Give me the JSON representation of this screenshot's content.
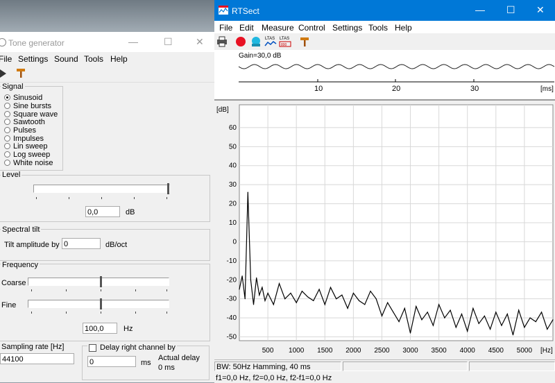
{
  "tone_generator": {
    "title": "Tone generator",
    "menu": [
      "File",
      "Settings",
      "Sound",
      "Tools",
      "Help"
    ],
    "signal": {
      "label": "Signal",
      "options": [
        "Sinusoid",
        "Sine bursts",
        "Square wave",
        "Sawtooth",
        "Pulses",
        "Impulses",
        "Lin sweep",
        "Log sweep",
        "White noise"
      ],
      "selected": "Sinusoid"
    },
    "level": {
      "label": "Level",
      "value": "0,0",
      "unit": "dB"
    },
    "spectral_tilt": {
      "label": "Spectral tilt",
      "field_label": "Tilt amplitude by",
      "value": "0",
      "unit": "dB/oct"
    },
    "frequency": {
      "label": "Frequency",
      "coarse_label": "Coarse",
      "fine_label": "Fine",
      "value": "100,0",
      "unit": "Hz"
    },
    "sampling_rate": {
      "label": "Sampling rate [Hz]",
      "value": "44100"
    },
    "delay": {
      "checkbox_label": "Delay right channel by",
      "value": "0",
      "unit": "ms",
      "actual_label": "Actual delay",
      "actual_value": "0 ms"
    }
  },
  "rtsect": {
    "title": "RTSect",
    "menu": [
      "File",
      "Edit",
      "Measure",
      "Control",
      "Settings",
      "Tools",
      "Help"
    ],
    "toolbar": [
      {
        "name": "print-icon",
        "label": ""
      },
      {
        "name": "record-icon",
        "label": ""
      },
      {
        "name": "monitor-icon",
        "label": ""
      },
      {
        "name": "ltas-icon",
        "label": "LTAS"
      },
      {
        "name": "ltas-800-icon",
        "label": "LTAS 800"
      },
      {
        "name": "tools-icon",
        "label": ""
      }
    ],
    "waveform": {
      "gain_label": "Gain=30,0 dB",
      "ticks": [
        "10",
        "20",
        "30"
      ],
      "unit": "[ms]"
    },
    "status": {
      "bw": "BW: 50Hz Hamming, 40 ms",
      "freq": "f1=0,0 Hz, f2=0,0 Hz, f2-f1=0,0 Hz"
    }
  },
  "colors": {
    "titlebar_active": "#0078d7",
    "record": "#e81123",
    "monitor": "#20b8e0"
  },
  "chart_data": {
    "type": "line",
    "title": "",
    "xlabel": "[Hz]",
    "ylabel": "[dB]",
    "xlim": [
      0,
      5500
    ],
    "ylim": [
      -52,
      72
    ],
    "x_ticks": [
      500,
      1000,
      1500,
      2000,
      2500,
      3000,
      3500,
      4000,
      4500,
      5000
    ],
    "y_ticks": [
      60,
      50,
      40,
      30,
      20,
      10,
      0,
      -10,
      -20,
      -30,
      -40,
      -50
    ],
    "grid": true,
    "x": [
      0,
      50,
      100,
      150,
      200,
      250,
      300,
      350,
      400,
      450,
      500,
      600,
      700,
      800,
      900,
      1000,
      1100,
      1200,
      1300,
      1400,
      1500,
      1600,
      1700,
      1800,
      1900,
      2000,
      2100,
      2200,
      2300,
      2400,
      2500,
      2600,
      2700,
      2800,
      2900,
      3000,
      3100,
      3200,
      3300,
      3400,
      3500,
      3600,
      3700,
      3800,
      3900,
      4000,
      4100,
      4200,
      4300,
      4400,
      4500,
      4600,
      4700,
      4800,
      4900,
      5000,
      5100,
      5200,
      5300,
      5400,
      5500
    ],
    "y": [
      -25,
      -18,
      -30,
      26,
      -20,
      -33,
      -19,
      -28,
      -24,
      -31,
      -27,
      -33,
      -22,
      -30,
      -27,
      -32,
      -26,
      -29,
      -31,
      -25,
      -33,
      -24,
      -30,
      -28,
      -35,
      -27,
      -31,
      -33,
      -26,
      -30,
      -39,
      -32,
      -37,
      -42,
      -35,
      -48,
      -34,
      -41,
      -37,
      -44,
      -33,
      -40,
      -36,
      -45,
      -38,
      -47,
      -35,
      -43,
      -39,
      -46,
      -37,
      -44,
      -38,
      -49,
      -36,
      -45,
      -40,
      -42,
      -37,
      -46,
      -41
    ]
  }
}
